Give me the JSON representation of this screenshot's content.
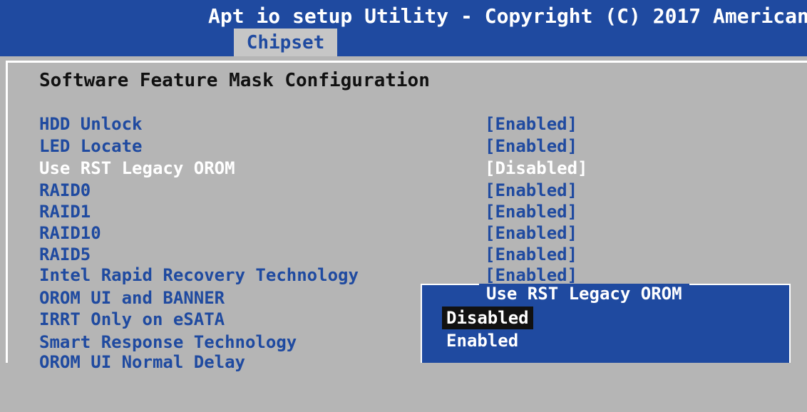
{
  "header": {
    "title": "Apt io setup Utility - Copyright (C) 2017 American",
    "tab": "Chipset"
  },
  "page": {
    "section_title": "Software Feature Mask Configuration"
  },
  "settings": [
    {
      "label": "HDD Unlock",
      "value": "[Enabled]"
    },
    {
      "label": "LED Locate",
      "value": "[Enabled]"
    },
    {
      "label": "Use RST Legacy OROM",
      "value": "[Disabled]"
    },
    {
      "label": "RAID0",
      "value": "[Enabled]"
    },
    {
      "label": "RAID1",
      "value": "[Enabled]"
    },
    {
      "label": "RAID10",
      "value": "[Enabled]"
    },
    {
      "label": "RAID5",
      "value": "[Enabled]"
    },
    {
      "label": "Intel Rapid Recovery Technology",
      "value": "[Enabled]"
    },
    {
      "label": "OROM UI and BANNER",
      "value": ""
    },
    {
      "label": "IRRT Only on eSATA",
      "value": ""
    },
    {
      "label": "Smart Response Technology",
      "value": ""
    },
    {
      "label": "OROM UI Normal Delay",
      "value": ""
    }
  ],
  "popup": {
    "title": "Use RST Legacy OROM",
    "options": [
      "Disabled",
      "Enabled"
    ],
    "selected": "Disabled"
  },
  "colors": {
    "header_blue": "#1f4aa0",
    "background_gray": "#b5b5b5",
    "text_white": "#ffffff"
  }
}
